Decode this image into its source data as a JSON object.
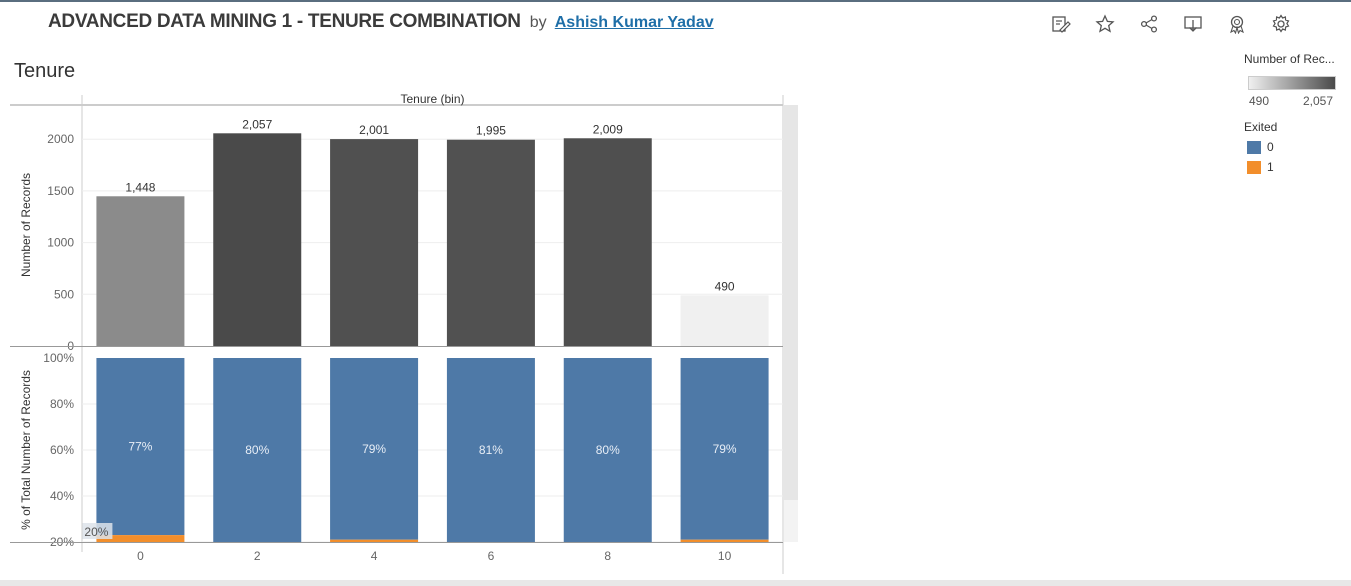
{
  "header": {
    "title": "ADVANCED DATA MINING 1 - TENURE COMBINATION",
    "by": "by",
    "author": "Ashish Kumar Yadav"
  },
  "toolbar": {
    "icons": [
      "edit-icon",
      "star-icon",
      "share-icon",
      "download-icon",
      "badge-icon",
      "settings-icon"
    ]
  },
  "sheet_title": "Tenure",
  "legend": {
    "color_title": "Number of Rec...",
    "color_min": "490",
    "color_max": "2,057",
    "exited_title": "Exited",
    "items": [
      {
        "label": "0",
        "color": "#4e79a7"
      },
      {
        "label": "1",
        "color": "#f28e2b"
      }
    ]
  },
  "chart_data": [
    {
      "type": "bar",
      "title": "",
      "xlabel": "Tenure (bin)",
      "ylabel": "Number of Records",
      "categories": [
        "0",
        "2",
        "4",
        "6",
        "8",
        "10"
      ],
      "values": [
        1448,
        2057,
        2001,
        1995,
        2009,
        490
      ],
      "data_labels": [
        "1,448",
        "2,057",
        "2,001",
        "1,995",
        "2,009",
        "490"
      ],
      "ylim": [
        0,
        2200
      ],
      "yticks": [
        "0",
        "500",
        "1000",
        "1500",
        "2000"
      ],
      "ytick_values": [
        0,
        500,
        1000,
        1500,
        2000
      ],
      "color_scale": {
        "min": 490,
        "max": 2057,
        "min_color": "#f0f0f0",
        "max_color": "#4a4a4a"
      },
      "grid": true
    },
    {
      "type": "bar",
      "stacked": true,
      "xlabel": "",
      "ylabel": "% of Total Number of Records",
      "categories": [
        "0",
        "2",
        "4",
        "6",
        "8",
        "10"
      ],
      "series": [
        {
          "name": "0",
          "color": "#4e79a7",
          "values": [
            0.77,
            0.8,
            0.79,
            0.81,
            0.8,
            0.79
          ],
          "labels": [
            "77%",
            "80%",
            "79%",
            "81%",
            "80%",
            "79%"
          ]
        },
        {
          "name": "1",
          "color": "#f28e2b",
          "values": [
            0.23,
            0.2,
            0.21,
            0.19,
            0.2,
            0.21
          ]
        }
      ],
      "visible_range": [
        0.2,
        1.0
      ],
      "yticks": [
        "20%",
        "40%",
        "60%",
        "80%",
        "100%"
      ],
      "ytick_values": [
        0.2,
        0.4,
        0.6,
        0.8,
        1.0
      ],
      "overflow_label": "20%",
      "grid": true
    }
  ]
}
